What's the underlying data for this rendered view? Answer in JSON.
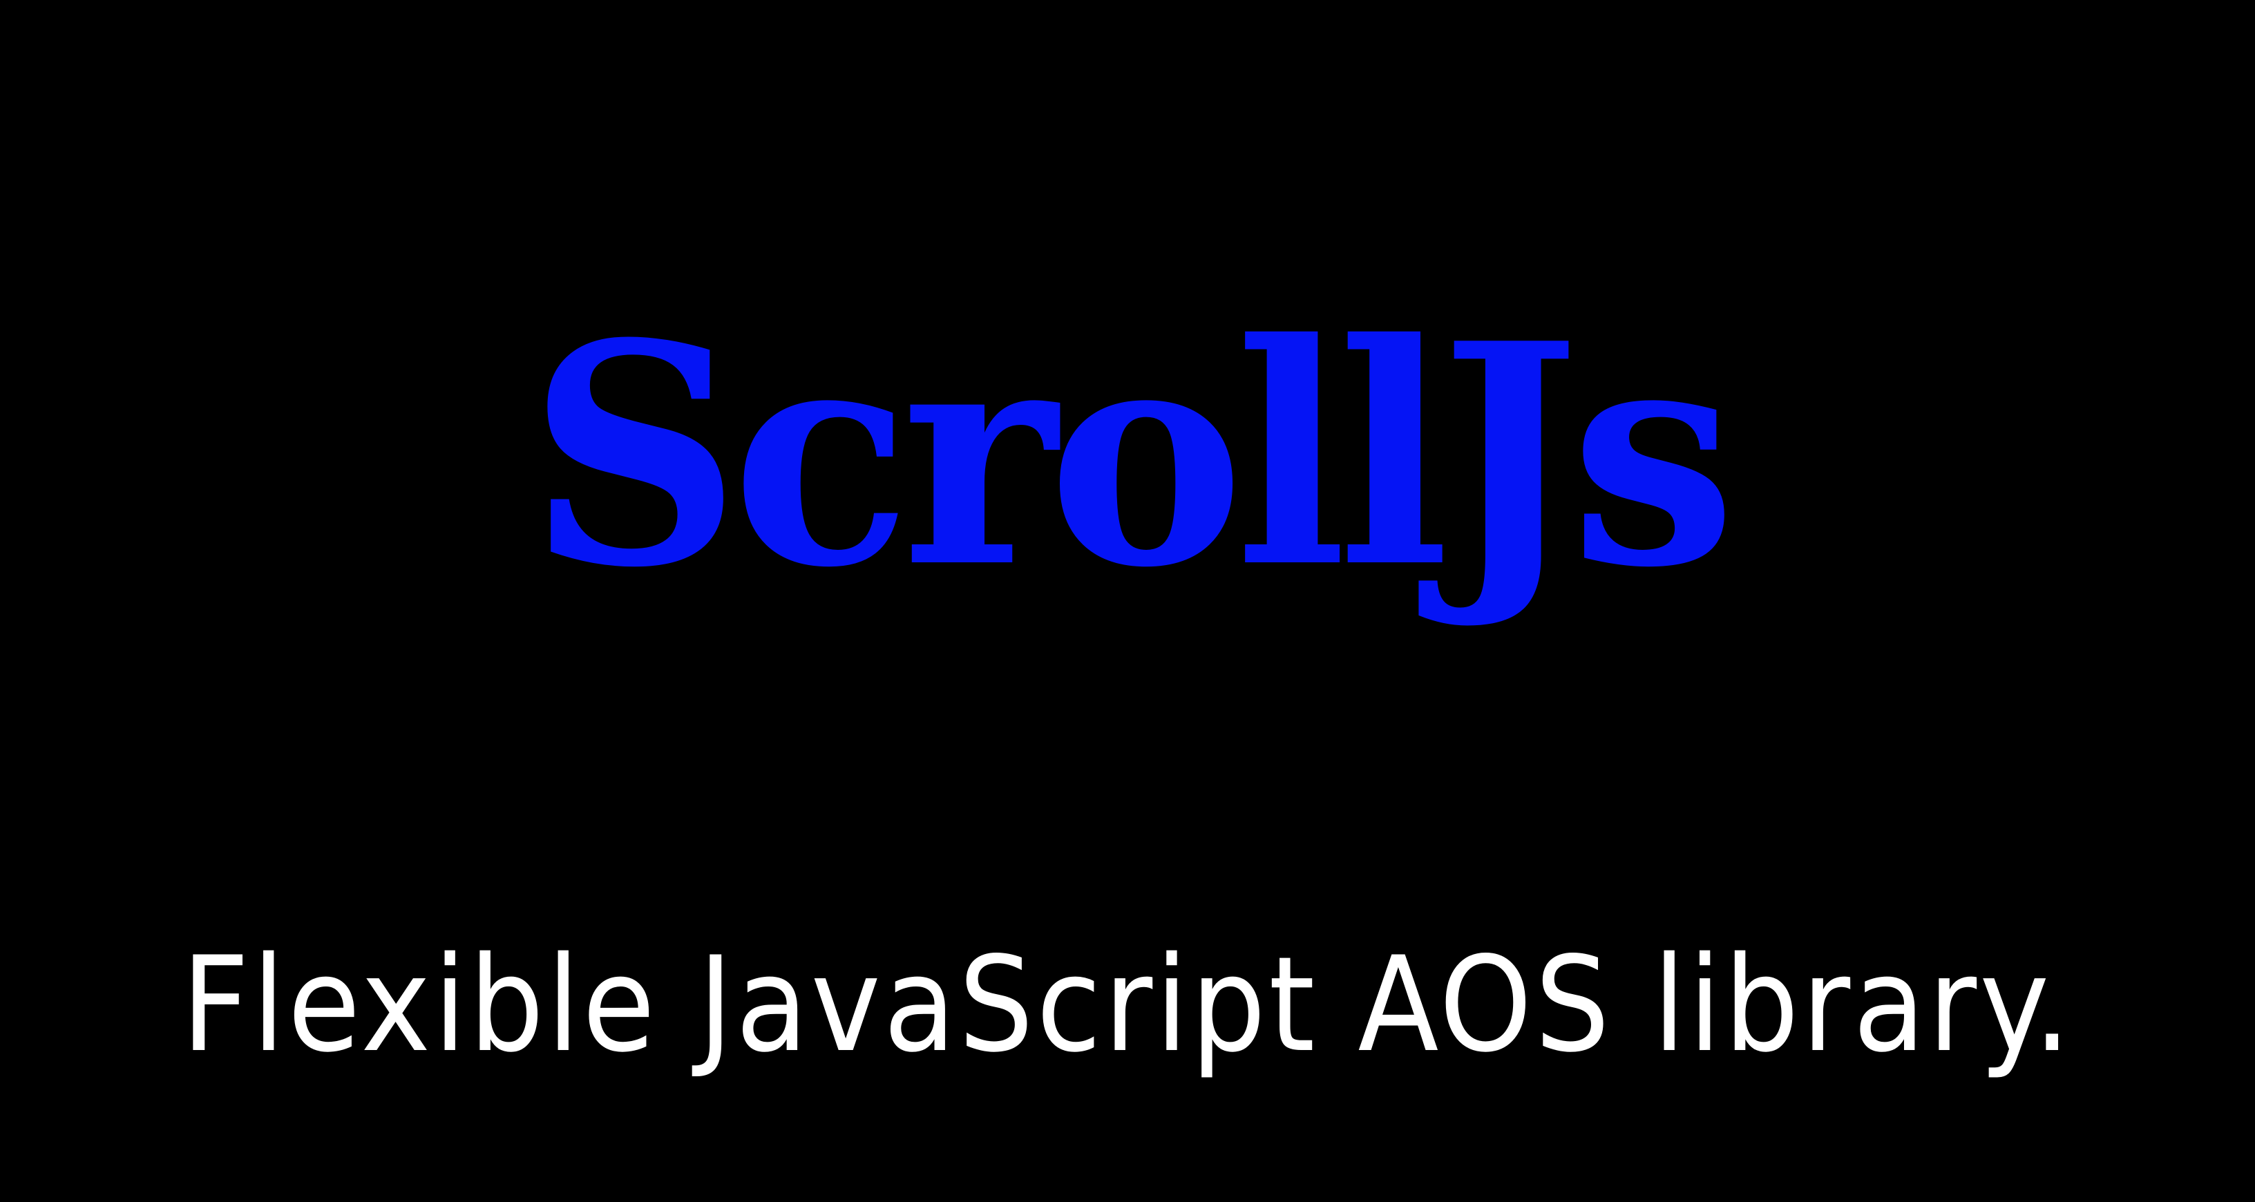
{
  "banner": {
    "title": "ScrollJs",
    "tagline": "Flexible JavaScript AOS library."
  },
  "colors": {
    "background": "#000000",
    "title": "#0514f5",
    "tagline": "#ffffff"
  }
}
